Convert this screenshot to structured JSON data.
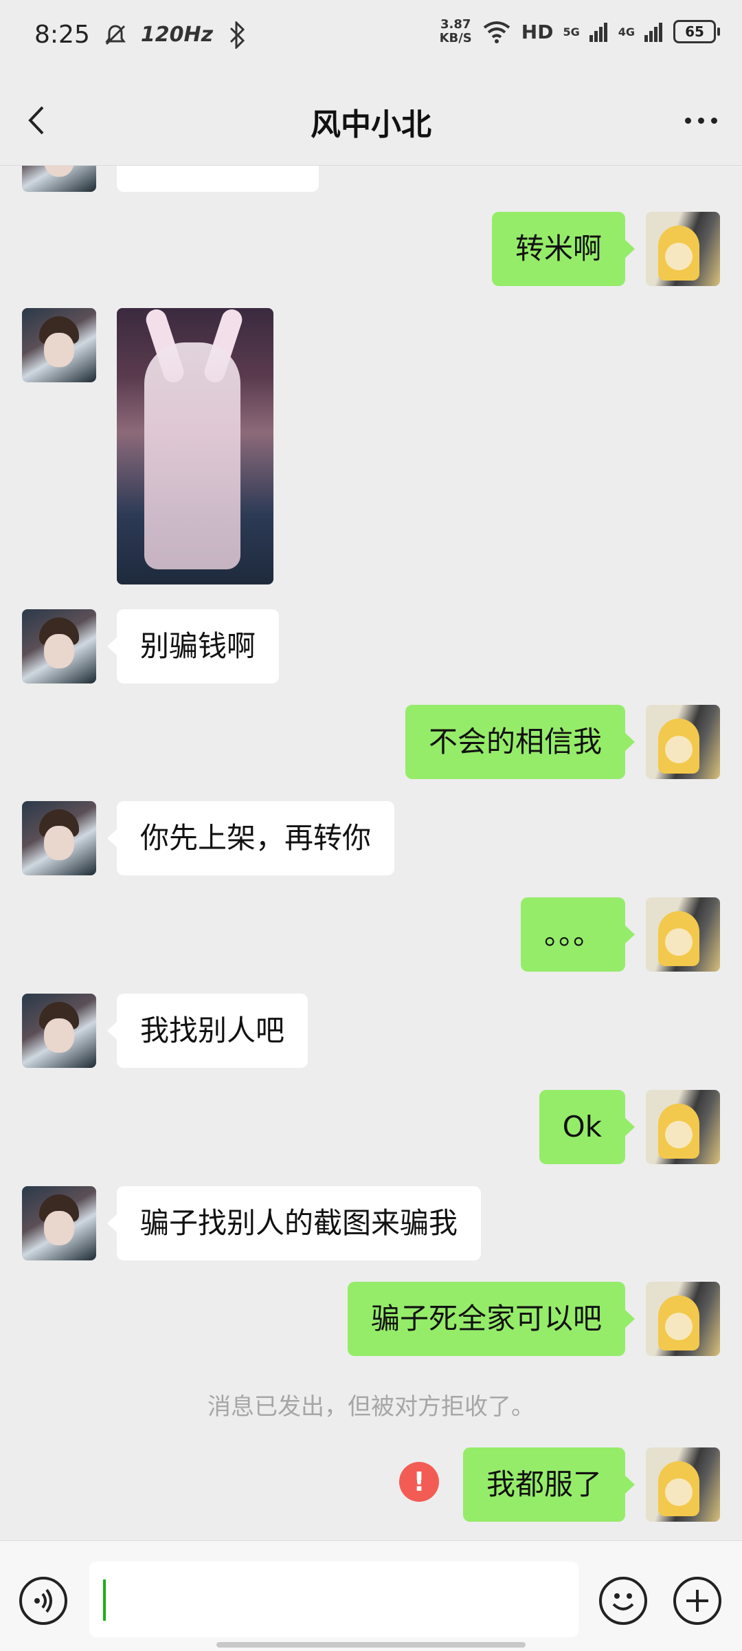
{
  "status_bar": {
    "time": "8:25",
    "refresh_rate": "120Hz",
    "net_speed_value": "3.87",
    "net_speed_unit": "KB/S",
    "hd_label": "HD",
    "net1": "5G",
    "net2": "4G",
    "battery": "65"
  },
  "header": {
    "title": "风中小北"
  },
  "messages": [
    {
      "from": "me",
      "type": "text",
      "text": "转米啊"
    },
    {
      "from": "peer",
      "type": "image"
    },
    {
      "from": "peer",
      "type": "text",
      "text": "别骗钱啊"
    },
    {
      "from": "me",
      "type": "text",
      "text": "不会的相信我"
    },
    {
      "from": "peer",
      "type": "text",
      "text": "你先上架，再转你"
    },
    {
      "from": "me",
      "type": "text",
      "text": "。。。"
    },
    {
      "from": "peer",
      "type": "text",
      "text": "我找别人吧"
    },
    {
      "from": "me",
      "type": "text",
      "text": "Ok"
    },
    {
      "from": "peer",
      "type": "text",
      "text": "骗子找别人的截图来骗我"
    },
    {
      "from": "me",
      "type": "text",
      "text": "骗子死全家可以吧"
    },
    {
      "from": "me",
      "type": "text",
      "text": "我都服了",
      "failed": true
    }
  ],
  "system_notice": "消息已发出，但被对方拒收了。",
  "error_mark": "!",
  "input": {
    "value": ""
  },
  "icons": {
    "back": "back-arrow-icon",
    "more": "more-icon",
    "voice": "voice-icon",
    "emoji": "emoji-icon",
    "plus": "plus-icon",
    "error": "error-icon"
  },
  "colors": {
    "me_bubble": "#95ec69",
    "peer_bubble": "#ffffff",
    "background": "#ededed",
    "error": "#f25c54"
  }
}
